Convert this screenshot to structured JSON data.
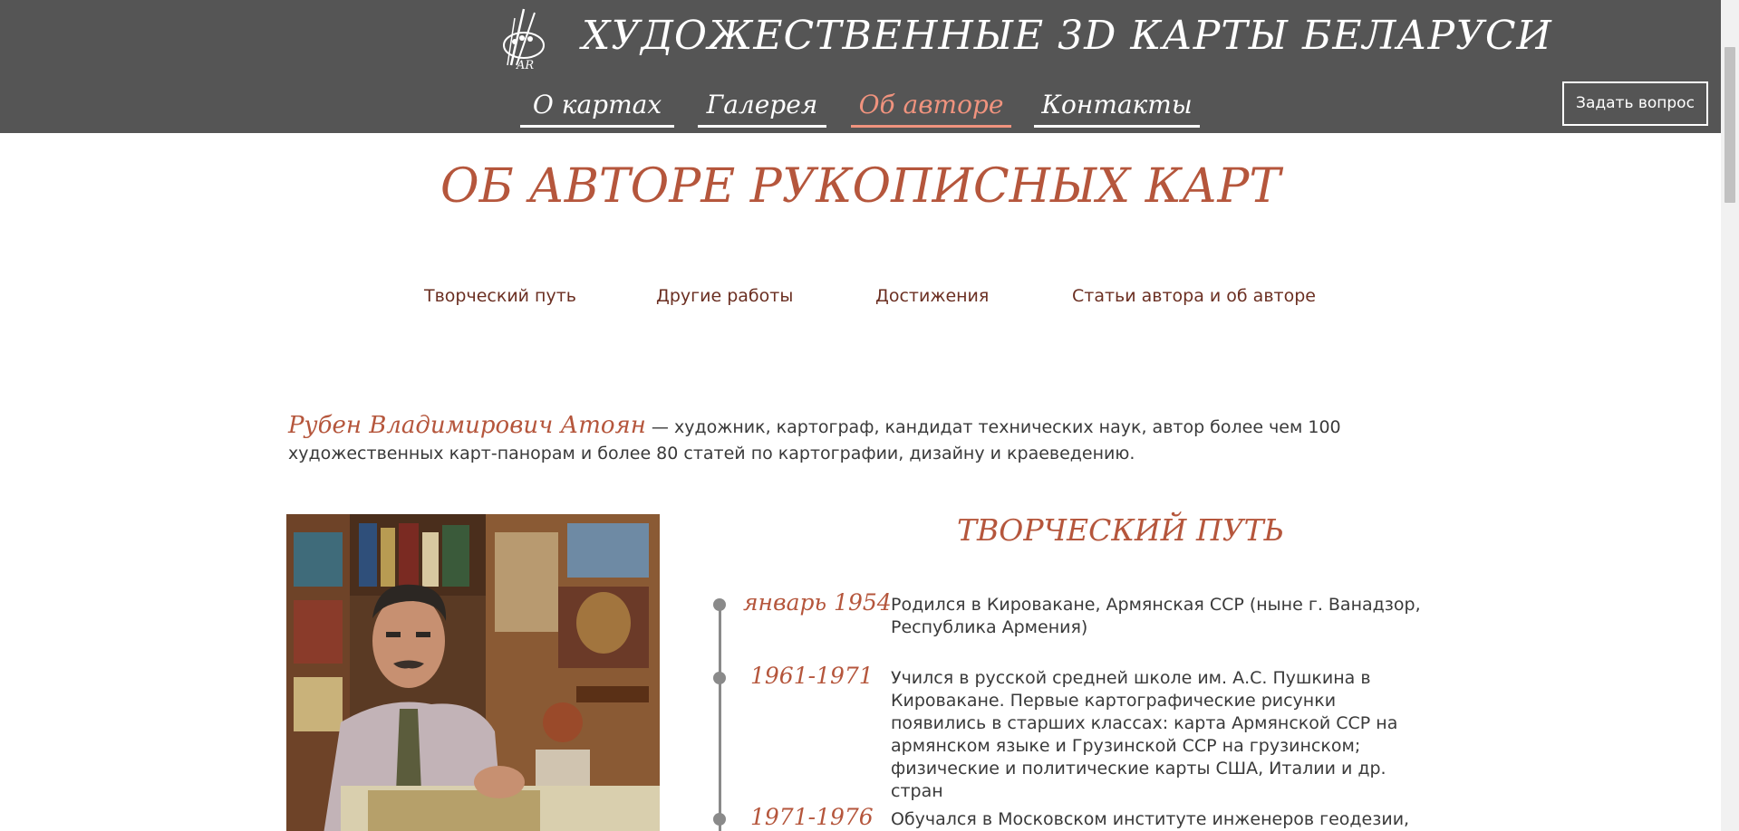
{
  "header": {
    "site_title": "ХУДОЖЕСТВЕННЫЕ 3D КАРТЫ БЕЛАРУСИ",
    "logo_text": "AR",
    "nav": [
      {
        "label": "О картах",
        "active": false
      },
      {
        "label": "Галерея",
        "active": false
      },
      {
        "label": "Об авторе",
        "active": true
      },
      {
        "label": "Контакты",
        "active": false
      }
    ],
    "ask_button": "Задать вопрос"
  },
  "main": {
    "page_title": "ОБ АВТОРЕ РУКОПИСНЫХ КАРТ",
    "subnav": [
      "Творческий путь",
      "Другие работы",
      "Достижения",
      "Статьи автора и об авторе"
    ],
    "intro": {
      "name": "Рубен Владимирович Атоян",
      "text": " — художник, картограф, кандидат технических наук, автор более чем 100 художественных карт-панорам и более 80 статей по картографии, дизайну и краеведению."
    },
    "section_title": "ТВОРЧЕСКИЙ ПУТЬ",
    "timeline": [
      {
        "date": "январь 1954",
        "text": "Родился в Кировакане, Армянская ССР (ныне г. Ванадзор, Республика Армения)"
      },
      {
        "date": "1961-1971",
        "text": "Учился в русской средней школе им. А.С. Пушкина в Кировакане. Первые картографические рисунки появились в старших классах: карта Армянской ССР на армянском языке и Грузинской ССР на грузинском; физические и политические карты США, Италии и др. стран"
      },
      {
        "date": "1971-1976",
        "text": "Обучался в Московском институте инженеров геодезии,"
      }
    ]
  },
  "colors": {
    "header_bg": "#555555",
    "accent": "#b5563c",
    "nav_active": "#f0937e",
    "subnav": "#6b2f22"
  }
}
